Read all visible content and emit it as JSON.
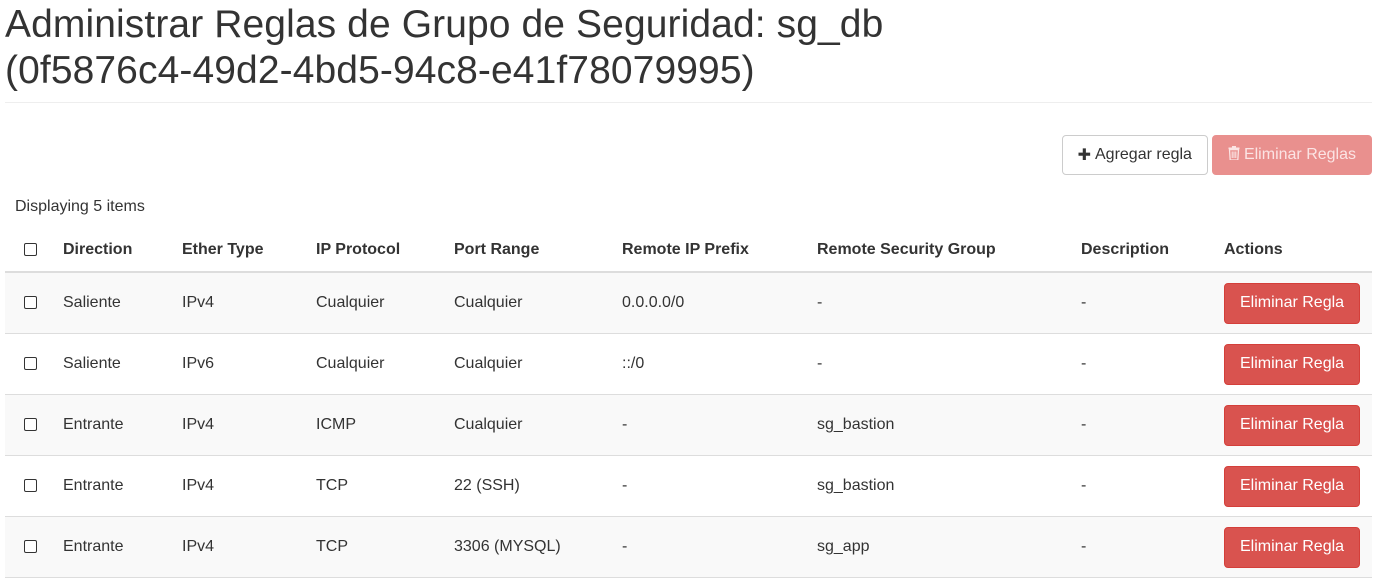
{
  "title": {
    "line1": "Administrar Reglas de Grupo de Seguridad: sg_db",
    "line2": "(0f5876c4-49d2-4bd5-94c8-e41f78079995)"
  },
  "toolbar": {
    "add_label": "Agregar regla",
    "add_icon": "plus-icon",
    "delete_label": "Eliminar Reglas",
    "delete_icon": "trash-icon"
  },
  "table": {
    "count_text": "Displaying 5 items",
    "headers": {
      "direction": "Direction",
      "ether_type": "Ether Type",
      "ip_protocol": "IP Protocol",
      "port_range": "Port Range",
      "remote_ip_prefix": "Remote IP Prefix",
      "remote_security_group": "Remote Security Group",
      "description": "Description",
      "actions": "Actions"
    },
    "rows": [
      {
        "direction": "Saliente",
        "ether_type": "IPv4",
        "ip_protocol": "Cualquier",
        "port_range": "Cualquier",
        "remote_ip_prefix": "0.0.0.0/0",
        "remote_security_group": "-",
        "description": "-",
        "action": "Eliminar Regla"
      },
      {
        "direction": "Saliente",
        "ether_type": "IPv6",
        "ip_protocol": "Cualquier",
        "port_range": "Cualquier",
        "remote_ip_prefix": "::/0",
        "remote_security_group": "-",
        "description": "-",
        "action": "Eliminar Regla"
      },
      {
        "direction": "Entrante",
        "ether_type": "IPv4",
        "ip_protocol": "ICMP",
        "port_range": "Cualquier",
        "remote_ip_prefix": "-",
        "remote_security_group": "sg_bastion",
        "description": "-",
        "action": "Eliminar Regla"
      },
      {
        "direction": "Entrante",
        "ether_type": "IPv4",
        "ip_protocol": "TCP",
        "port_range": "22 (SSH)",
        "remote_ip_prefix": "-",
        "remote_security_group": "sg_bastion",
        "description": "-",
        "action": "Eliminar Regla"
      },
      {
        "direction": "Entrante",
        "ether_type": "IPv4",
        "ip_protocol": "TCP",
        "port_range": "3306 (MYSQL)",
        "remote_ip_prefix": "-",
        "remote_security_group": "sg_app",
        "description": "-",
        "action": "Eliminar Regla"
      }
    ]
  },
  "colors": {
    "danger": "#d9534f",
    "danger_disabled": "#e9908e",
    "text": "#333333",
    "row_stripe": "#f9f9f9"
  }
}
